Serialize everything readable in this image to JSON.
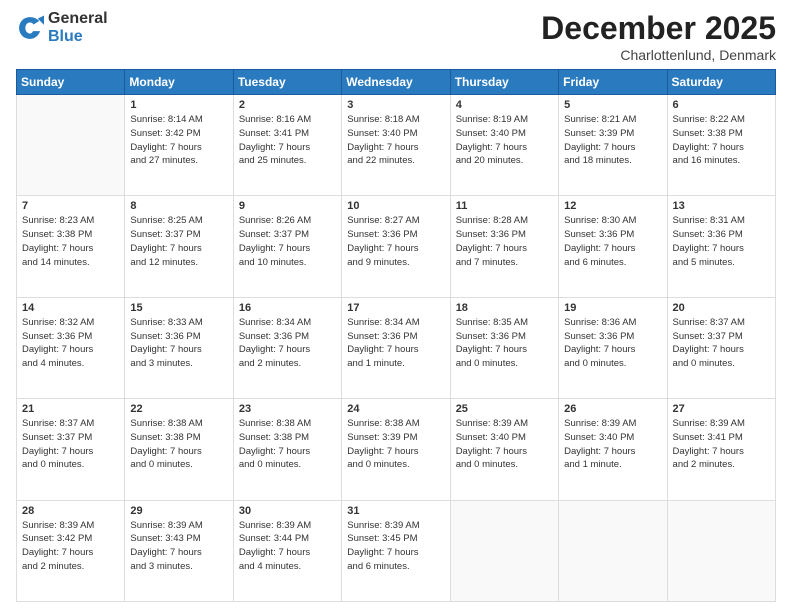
{
  "logo": {
    "general": "General",
    "blue": "Blue"
  },
  "header": {
    "month": "December 2025",
    "location": "Charlottenlund, Denmark"
  },
  "days_of_week": [
    "Sunday",
    "Monday",
    "Tuesday",
    "Wednesday",
    "Thursday",
    "Friday",
    "Saturday"
  ],
  "weeks": [
    [
      {
        "day": "",
        "info": ""
      },
      {
        "day": "1",
        "info": "Sunrise: 8:14 AM\nSunset: 3:42 PM\nDaylight: 7 hours\nand 27 minutes."
      },
      {
        "day": "2",
        "info": "Sunrise: 8:16 AM\nSunset: 3:41 PM\nDaylight: 7 hours\nand 25 minutes."
      },
      {
        "day": "3",
        "info": "Sunrise: 8:18 AM\nSunset: 3:40 PM\nDaylight: 7 hours\nand 22 minutes."
      },
      {
        "day": "4",
        "info": "Sunrise: 8:19 AM\nSunset: 3:40 PM\nDaylight: 7 hours\nand 20 minutes."
      },
      {
        "day": "5",
        "info": "Sunrise: 8:21 AM\nSunset: 3:39 PM\nDaylight: 7 hours\nand 18 minutes."
      },
      {
        "day": "6",
        "info": "Sunrise: 8:22 AM\nSunset: 3:38 PM\nDaylight: 7 hours\nand 16 minutes."
      }
    ],
    [
      {
        "day": "7",
        "info": "Sunrise: 8:23 AM\nSunset: 3:38 PM\nDaylight: 7 hours\nand 14 minutes."
      },
      {
        "day": "8",
        "info": "Sunrise: 8:25 AM\nSunset: 3:37 PM\nDaylight: 7 hours\nand 12 minutes."
      },
      {
        "day": "9",
        "info": "Sunrise: 8:26 AM\nSunset: 3:37 PM\nDaylight: 7 hours\nand 10 minutes."
      },
      {
        "day": "10",
        "info": "Sunrise: 8:27 AM\nSunset: 3:36 PM\nDaylight: 7 hours\nand 9 minutes."
      },
      {
        "day": "11",
        "info": "Sunrise: 8:28 AM\nSunset: 3:36 PM\nDaylight: 7 hours\nand 7 minutes."
      },
      {
        "day": "12",
        "info": "Sunrise: 8:30 AM\nSunset: 3:36 PM\nDaylight: 7 hours\nand 6 minutes."
      },
      {
        "day": "13",
        "info": "Sunrise: 8:31 AM\nSunset: 3:36 PM\nDaylight: 7 hours\nand 5 minutes."
      }
    ],
    [
      {
        "day": "14",
        "info": "Sunrise: 8:32 AM\nSunset: 3:36 PM\nDaylight: 7 hours\nand 4 minutes."
      },
      {
        "day": "15",
        "info": "Sunrise: 8:33 AM\nSunset: 3:36 PM\nDaylight: 7 hours\nand 3 minutes."
      },
      {
        "day": "16",
        "info": "Sunrise: 8:34 AM\nSunset: 3:36 PM\nDaylight: 7 hours\nand 2 minutes."
      },
      {
        "day": "17",
        "info": "Sunrise: 8:34 AM\nSunset: 3:36 PM\nDaylight: 7 hours\nand 1 minute."
      },
      {
        "day": "18",
        "info": "Sunrise: 8:35 AM\nSunset: 3:36 PM\nDaylight: 7 hours\nand 0 minutes."
      },
      {
        "day": "19",
        "info": "Sunrise: 8:36 AM\nSunset: 3:36 PM\nDaylight: 7 hours\nand 0 minutes."
      },
      {
        "day": "20",
        "info": "Sunrise: 8:37 AM\nSunset: 3:37 PM\nDaylight: 7 hours\nand 0 minutes."
      }
    ],
    [
      {
        "day": "21",
        "info": "Sunrise: 8:37 AM\nSunset: 3:37 PM\nDaylight: 7 hours\nand 0 minutes."
      },
      {
        "day": "22",
        "info": "Sunrise: 8:38 AM\nSunset: 3:38 PM\nDaylight: 7 hours\nand 0 minutes."
      },
      {
        "day": "23",
        "info": "Sunrise: 8:38 AM\nSunset: 3:38 PM\nDaylight: 7 hours\nand 0 minutes."
      },
      {
        "day": "24",
        "info": "Sunrise: 8:38 AM\nSunset: 3:39 PM\nDaylight: 7 hours\nand 0 minutes."
      },
      {
        "day": "25",
        "info": "Sunrise: 8:39 AM\nSunset: 3:40 PM\nDaylight: 7 hours\nand 0 minutes."
      },
      {
        "day": "26",
        "info": "Sunrise: 8:39 AM\nSunset: 3:40 PM\nDaylight: 7 hours\nand 1 minute."
      },
      {
        "day": "27",
        "info": "Sunrise: 8:39 AM\nSunset: 3:41 PM\nDaylight: 7 hours\nand 2 minutes."
      }
    ],
    [
      {
        "day": "28",
        "info": "Sunrise: 8:39 AM\nSunset: 3:42 PM\nDaylight: 7 hours\nand 2 minutes."
      },
      {
        "day": "29",
        "info": "Sunrise: 8:39 AM\nSunset: 3:43 PM\nDaylight: 7 hours\nand 3 minutes."
      },
      {
        "day": "30",
        "info": "Sunrise: 8:39 AM\nSunset: 3:44 PM\nDaylight: 7 hours\nand 4 minutes."
      },
      {
        "day": "31",
        "info": "Sunrise: 8:39 AM\nSunset: 3:45 PM\nDaylight: 7 hours\nand 6 minutes."
      },
      {
        "day": "",
        "info": ""
      },
      {
        "day": "",
        "info": ""
      },
      {
        "day": "",
        "info": ""
      }
    ]
  ]
}
